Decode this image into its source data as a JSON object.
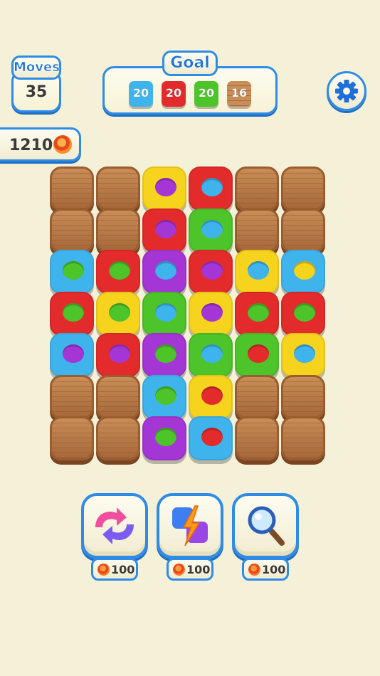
{
  "moves": {
    "label": "Moves",
    "value": "35"
  },
  "goal": {
    "label": "Goal",
    "items": [
      {
        "count": "20",
        "kind": "blue",
        "color": "#3fb4ec"
      },
      {
        "count": "20",
        "kind": "red",
        "color": "#e32b2b"
      },
      {
        "count": "20",
        "kind": "green",
        "color": "#4cc42a"
      },
      {
        "count": "16",
        "kind": "wood",
        "color": "#b8773f"
      }
    ]
  },
  "settings": {
    "icon": "gear-icon"
  },
  "coins": {
    "value": "1210",
    "icon": "coin-icon"
  },
  "palette": {
    "blue": "#3fb4ec",
    "red": "#e32b2b",
    "green": "#4cc42a",
    "yellow": "#f6d31c",
    "purple": "#a536d6",
    "wood": "#b8773f",
    "accent": "#2f8ce6",
    "background": "#f5f1d8"
  },
  "board": {
    "rows": 7,
    "cols": 6,
    "cells": [
      [
        "wood",
        "wood",
        [
          "yellow",
          "purple"
        ],
        [
          "red",
          "blue"
        ],
        "wood",
        "wood"
      ],
      [
        "wood",
        "wood",
        [
          "red",
          "purple"
        ],
        [
          "green",
          "blue"
        ],
        "wood",
        "wood"
      ],
      [
        [
          "blue",
          "green"
        ],
        [
          "red",
          "green"
        ],
        [
          "purple",
          "blue"
        ],
        [
          "red",
          "purple"
        ],
        [
          "yellow",
          "blue"
        ],
        [
          "blue",
          "yellow"
        ]
      ],
      [
        [
          "red",
          "green"
        ],
        [
          "yellow",
          "green"
        ],
        [
          "green",
          "blue"
        ],
        [
          "yellow",
          "purple"
        ],
        [
          "red",
          "green"
        ],
        [
          "red",
          "green"
        ]
      ],
      [
        [
          "blue",
          "purple"
        ],
        [
          "red",
          "purple"
        ],
        [
          "purple",
          "green"
        ],
        [
          "green",
          "blue"
        ],
        [
          "green",
          "red"
        ],
        [
          "yellow",
          "blue"
        ]
      ],
      [
        "wood",
        "wood",
        [
          "blue",
          "green"
        ],
        [
          "yellow",
          "red"
        ],
        "wood",
        "wood"
      ],
      [
        "wood",
        "wood",
        [
          "purple",
          "green"
        ],
        [
          "blue",
          "red"
        ],
        "wood",
        "wood"
      ]
    ]
  },
  "boosters": [
    {
      "name": "shuffle",
      "icon": "shuffle-icon",
      "cost": "100"
    },
    {
      "name": "lightning",
      "icon": "lightning-icon",
      "cost": "100"
    },
    {
      "name": "magnifier",
      "icon": "magnifier-icon",
      "cost": "100"
    }
  ]
}
